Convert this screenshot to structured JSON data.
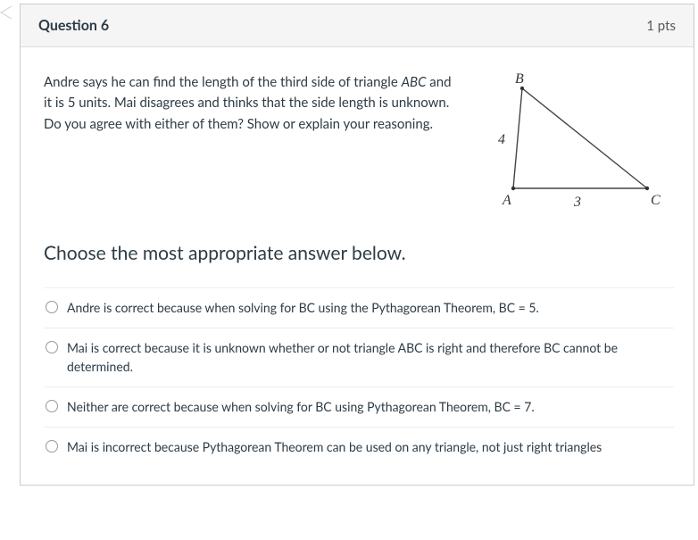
{
  "header": {
    "title": "Question 6",
    "points": "1 pts"
  },
  "prompt": {
    "text_before": "Andre says he can find the length of the third side of triangle ",
    "triangle_name": "ABC",
    "text_after": " and it is 5 units. Mai disagrees and thinks that the side length is unknown. Do you agree with either of them? Show or explain your reasoning."
  },
  "figure": {
    "label_B": "B",
    "label_A": "A",
    "label_C": "C",
    "side_AB": "4",
    "side_AC": "3"
  },
  "sub_prompt": "Choose the most appropriate answer below.",
  "options": [
    "Andre is correct because when solving for BC using the Pythagorean Theorem, BC = 5.",
    "Mai is correct because it is unknown whether or not triangle ABC is right and therefore BC cannot be determined.",
    "Neither are correct because when solving for BC using Pythagorean Theorem, BC = 7.",
    "Mai is incorrect because Pythagorean Theorem can be used on any triangle, not just right triangles"
  ]
}
